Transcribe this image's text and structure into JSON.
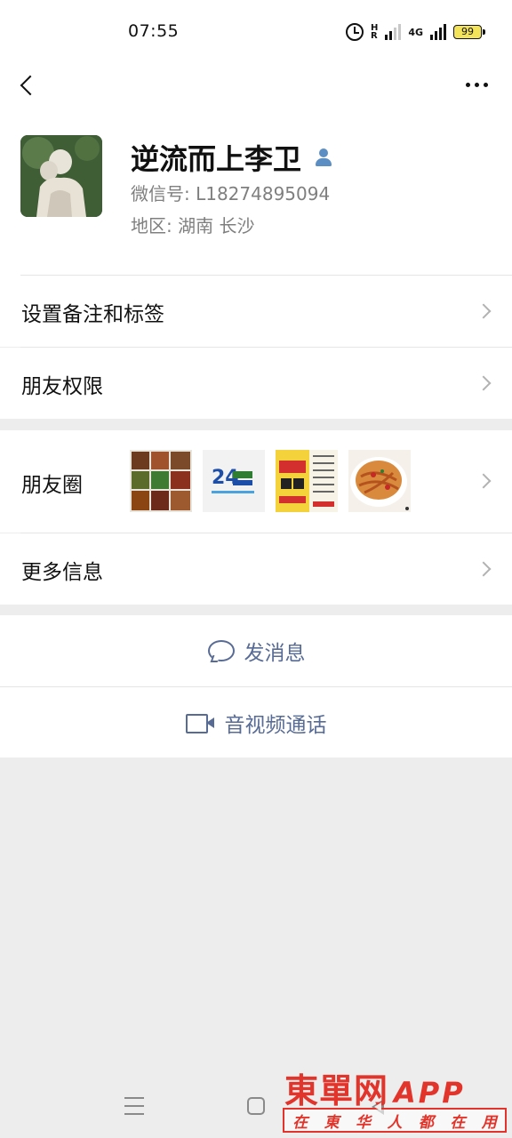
{
  "status_bar": {
    "time": "07:55",
    "network_label_1": "H",
    "network_label_1b": "R",
    "network_label_2": "4G",
    "battery": "99"
  },
  "profile": {
    "nickname": "逆流而上李卫",
    "wechat_id": "微信号:  L18274895094",
    "region": "地区:  湖南  长沙"
  },
  "rows": {
    "remark_tags": "设置备注和标签",
    "permissions": "朋友权限",
    "moments": "朋友圈",
    "more_info": "更多信息"
  },
  "actions": {
    "send_message": "发消息",
    "video_call": "音视频通话"
  },
  "watermark": {
    "brand": "東單网",
    "app": "APP",
    "chars": [
      "在",
      "東",
      "华",
      "人",
      "都",
      "在",
      "用"
    ]
  },
  "colors": {
    "link_blue": "#576b95",
    "background": "#ededed",
    "watermark_red": "#e2342a",
    "verified_icon": "#5b8fc4"
  },
  "icons": [
    "back-icon",
    "more-icon",
    "user-icon",
    "message-icon",
    "video-icon",
    "chevron-right-icon",
    "alarm-icon",
    "battery-icon"
  ]
}
